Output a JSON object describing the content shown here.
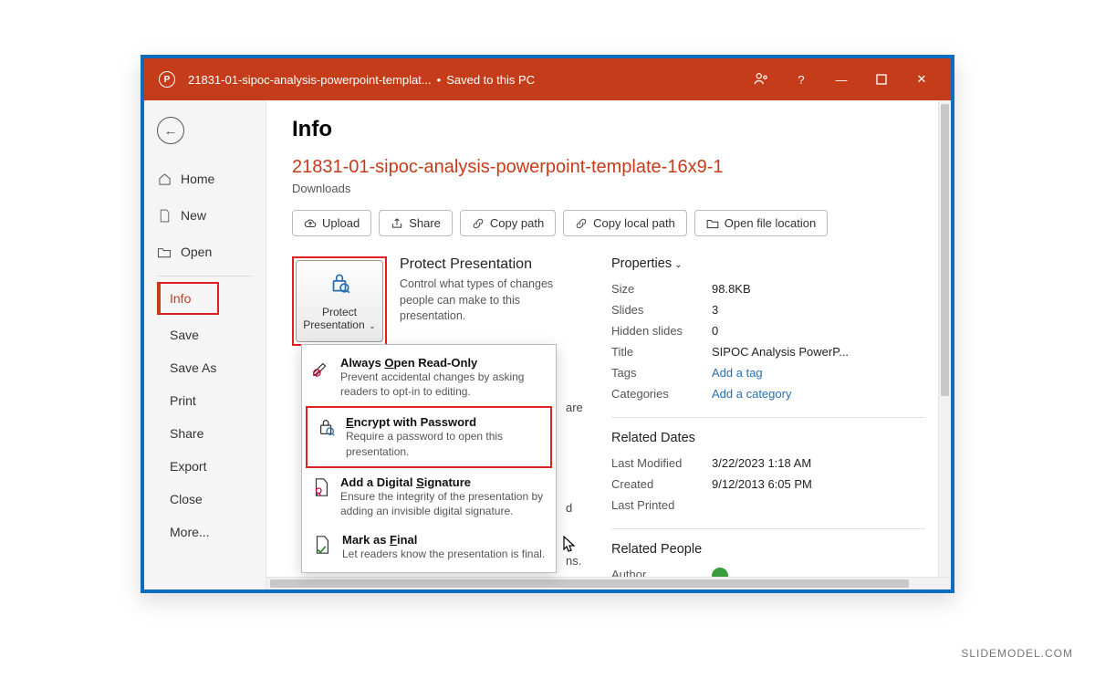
{
  "titlebar": {
    "filename": "21831-01-sipoc-analysis-powerpoint-templat...",
    "save_status": "Saved to this PC"
  },
  "sidebar": {
    "items": [
      {
        "icon": "home",
        "label": "Home"
      },
      {
        "icon": "new",
        "label": "New"
      },
      {
        "icon": "open",
        "label": "Open"
      }
    ],
    "sub_items": [
      "Info",
      "Save",
      "Save As",
      "Print",
      "Share",
      "Export",
      "Close",
      "More..."
    ]
  },
  "header": {
    "title": "Info",
    "file_title": "21831-01-sipoc-analysis-powerpoint-template-16x9-1",
    "file_path": "Downloads"
  },
  "actions": [
    "Upload",
    "Share",
    "Copy path",
    "Copy local path",
    "Open file location"
  ],
  "protect": {
    "button_label": "Protect Presentation",
    "section_title": "Protect Presentation",
    "section_desc": "Control what types of changes people can make to this presentation."
  },
  "menu": [
    {
      "title_pre": "Always ",
      "title_ul": "O",
      "title_post": "pen Read-Only",
      "desc": "Prevent accidental changes by asking readers to opt-in to editing."
    },
    {
      "title_pre": "",
      "title_ul": "E",
      "title_post": "ncrypt with Password",
      "desc": "Require a password to open this presentation."
    },
    {
      "title_pre": "Add a Digital ",
      "title_ul": "S",
      "title_post": "ignature",
      "desc": "Ensure the integrity of the presentation by adding an invisible digital signature."
    },
    {
      "title_pre": "Mark as ",
      "title_ul": "F",
      "title_post": "inal",
      "desc": "Let readers know the presentation is final."
    }
  ],
  "faint": {
    "a": "are",
    "b": "d",
    "c": "ns."
  },
  "properties": {
    "header": "Properties",
    "rows": [
      {
        "k": "Size",
        "v": "98.8KB"
      },
      {
        "k": "Slides",
        "v": "3"
      },
      {
        "k": "Hidden slides",
        "v": "0"
      },
      {
        "k": "Title",
        "v": "SIPOC Analysis PowerP..."
      },
      {
        "k": "Tags",
        "v": "Add a tag",
        "link": true
      },
      {
        "k": "Categories",
        "v": "Add a category",
        "link": true
      }
    ]
  },
  "dates": {
    "header": "Related Dates",
    "rows": [
      {
        "k": "Last Modified",
        "v": "3/22/2023 1:18 AM"
      },
      {
        "k": "Created",
        "v": "9/12/2013 6:05 PM"
      },
      {
        "k": "Last Printed",
        "v": ""
      }
    ]
  },
  "people": {
    "header": "Related People",
    "author_label": "Author"
  },
  "watermark": "SLIDEMODEL.COM"
}
